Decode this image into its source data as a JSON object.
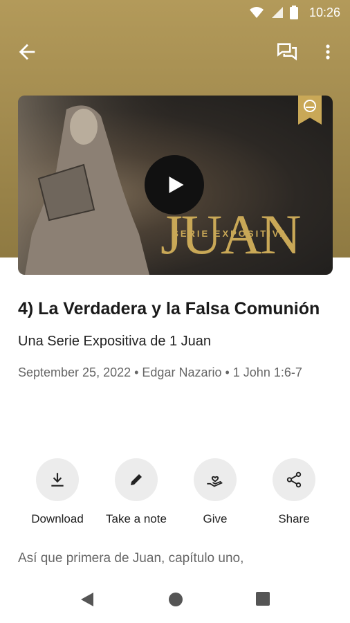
{
  "status_bar": {
    "time": "10:26"
  },
  "app_bar": {
    "back_icon": "arrow-left-icon",
    "chat_icon": "chat-icon",
    "more_icon": "more-vert-icon"
  },
  "video": {
    "art_title": "1 JUAN",
    "art_subtitle": "SERIE EXPOSITIVA",
    "play_icon": "play-icon"
  },
  "sermon": {
    "title": "4) La Verdadera y la Falsa Comunión",
    "series": "Una Serie Expositiva de 1 Juan",
    "meta": "September 25, 2022 • Edgar Nazario • 1 John 1:6-7"
  },
  "actions": [
    {
      "label": "Download",
      "icon": "download-icon"
    },
    {
      "label": "Take a note",
      "icon": "pencil-icon"
    },
    {
      "label": "Give",
      "icon": "give-hand-heart-icon"
    },
    {
      "label": "Share",
      "icon": "share-icon"
    }
  ],
  "body_text": "Así que primera de Juan, capítulo uno,",
  "colors": {
    "header": "#a58e50",
    "accent_gold": "#c9a857"
  }
}
